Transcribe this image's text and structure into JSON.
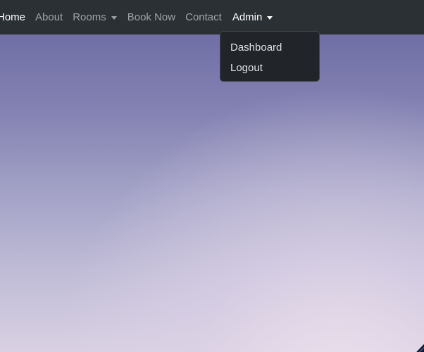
{
  "nav": {
    "home": "Home",
    "about": "About",
    "rooms": "Rooms",
    "book_now": "Book Now",
    "contact": "Contact",
    "admin": "Admin"
  },
  "admin_menu": {
    "items": [
      "Dashboard",
      "Logout"
    ]
  },
  "colors": {
    "navbar_bg": "#2b3035",
    "dropdown_bg": "#212529",
    "nav_active": "#ffffff",
    "nav_inactive": "rgba(255,255,255,0.55)"
  }
}
